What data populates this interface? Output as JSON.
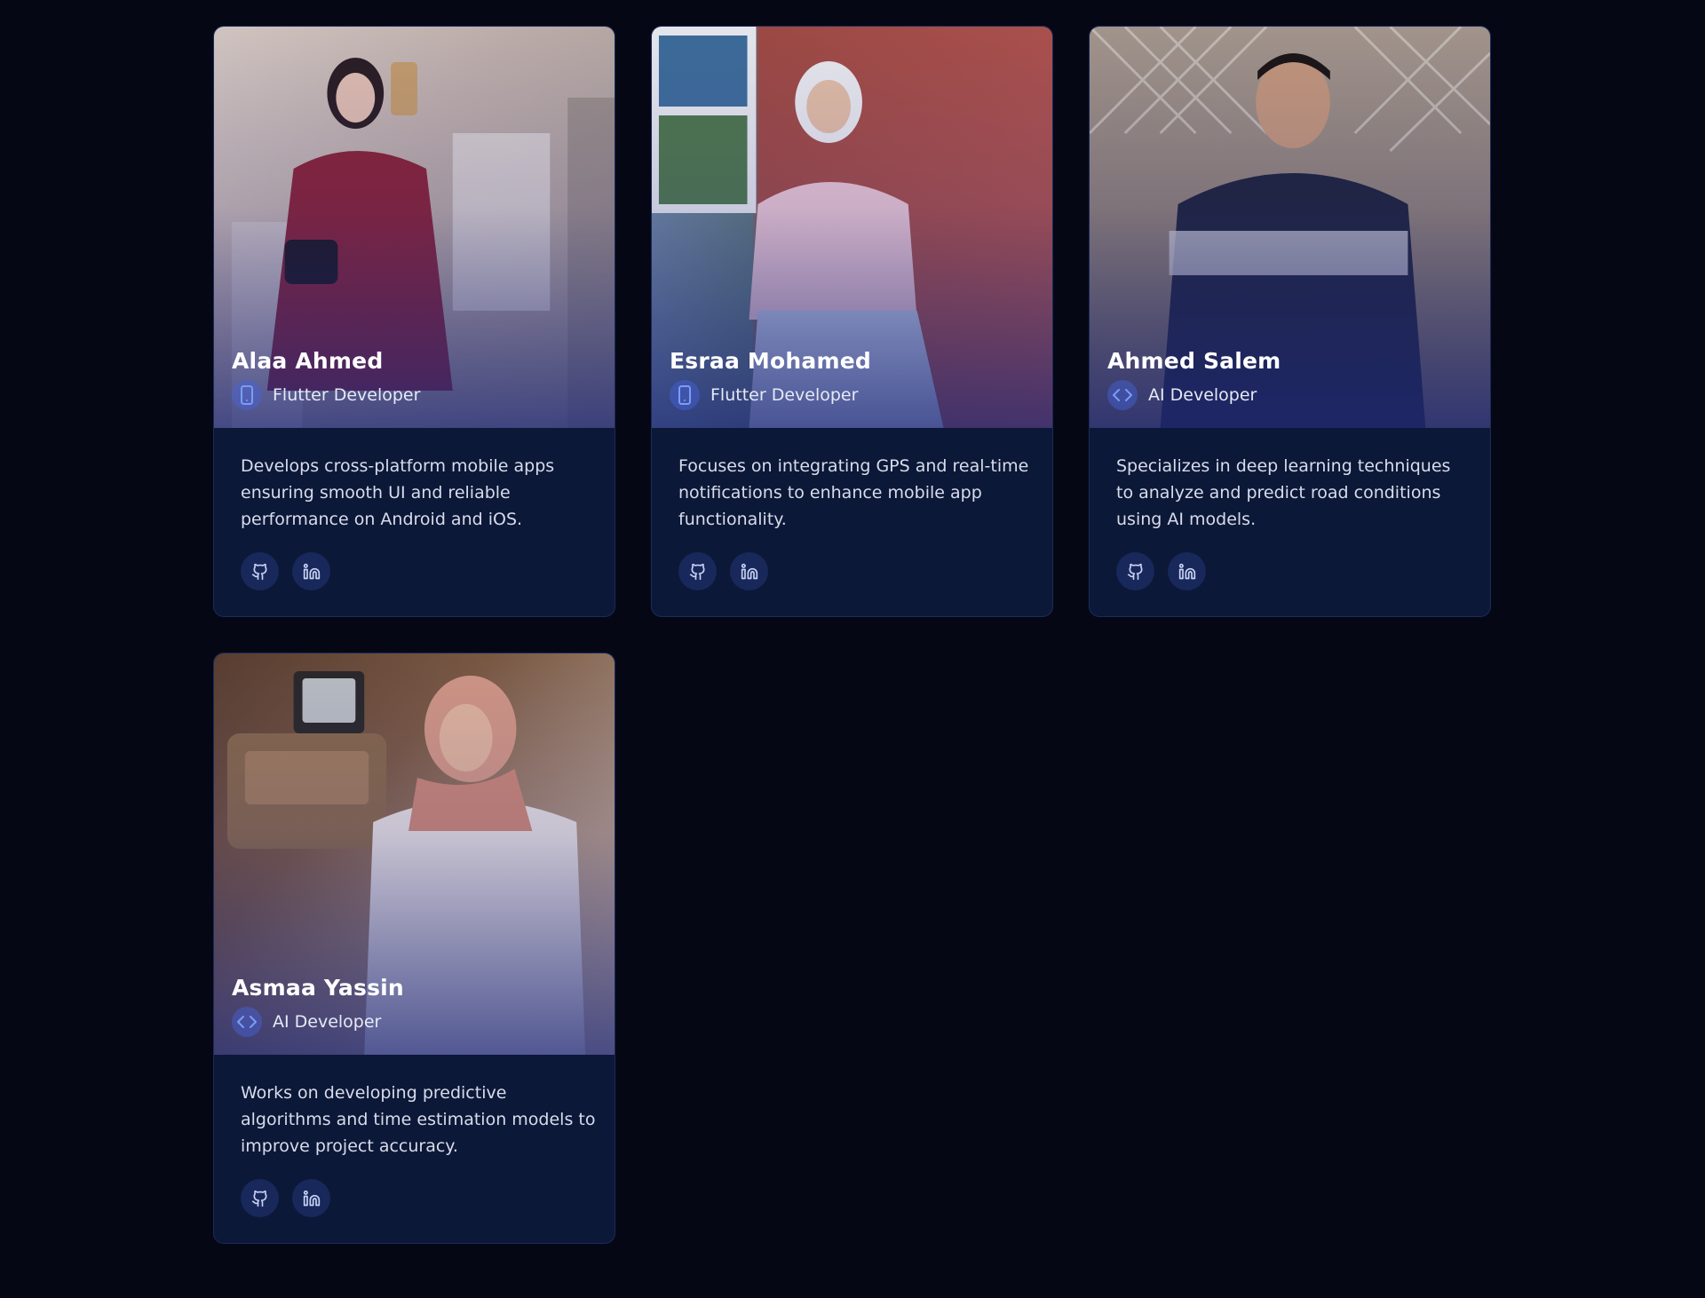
{
  "team": [
    {
      "name": "Alaa Ahmed",
      "role": "Flutter Developer",
      "role_icon": "mobile-icon",
      "description": "Develops cross-platform mobile apps ensuring smooth UI and reliable performance on Android and iOS.",
      "photo_colors": [
        "#cbbcb4",
        "#8c2131"
      ]
    },
    {
      "name": "Esraa Mohamed",
      "role": "Flutter Developer",
      "role_icon": "mobile-icon",
      "description": "Focuses on integrating GPS and real-time notifications to enhance mobile app functionality.",
      "photo_colors": [
        "#a4473f",
        "#f2cdd5"
      ]
    },
    {
      "name": "Ahmed Salem",
      "role": "AI Developer",
      "role_icon": "code-icon",
      "description": "Specializes in deep learning techniques to analyze and predict road conditions using AI models.",
      "photo_colors": [
        "#8f8173",
        "#1c2236"
      ]
    },
    {
      "name": "Asmaa Yassin",
      "role": "AI Developer",
      "role_icon": "code-icon",
      "description": "Works on developing predictive algorithms and time estimation models to improve project accuracy.",
      "photo_colors": [
        "#6b4a35",
        "#e8e2dc"
      ]
    }
  ],
  "socials": [
    "github-icon",
    "linkedin-icon"
  ],
  "colors": {
    "page_bg": "#050814",
    "card_bg": "#0c1838",
    "accent": "#4a6bdc"
  }
}
